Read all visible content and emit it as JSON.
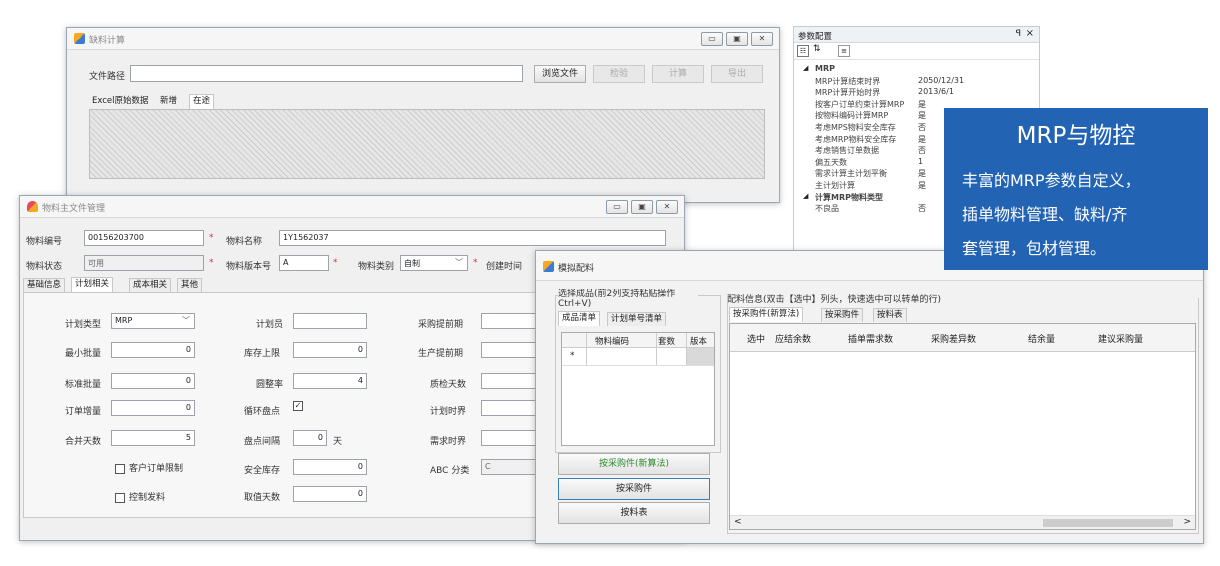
{
  "shortage_window": {
    "title": "缺料计算",
    "file_path_label": "文件路径",
    "file_path_value": "",
    "buttons": [
      "浏览文件",
      "检验",
      "计算",
      "导出"
    ],
    "tabs": [
      "Excel原始数据",
      "新增",
      "在途"
    ]
  },
  "material_window": {
    "title": "物料主文件管理",
    "code_label": "物料编号",
    "code_value": "00156203700",
    "name_label": "物料名称",
    "name_value": "1Y1562037",
    "status_label": "物料状态",
    "status_value": "可用",
    "version_label": "物料版本号",
    "version_value": "A",
    "category_label": "物料类别",
    "category_value": "自制",
    "created_label": "创建时间",
    "required_mark": "*",
    "tabs": [
      "基础信息",
      "计划相关",
      "成本相关",
      "其他"
    ],
    "active_tab_index": 1,
    "fields": {
      "plan_type": {
        "label": "计划类型",
        "value": "MRP"
      },
      "min_batch": {
        "label": "最小批量",
        "value": "0"
      },
      "std_batch": {
        "label": "标准批量",
        "value": "0"
      },
      "order_increment": {
        "label": "订单增量",
        "value": "0"
      },
      "merge_days": {
        "label": "合并天数",
        "value": "5"
      },
      "customer_limit": {
        "label": "客户订单限制",
        "checked": false
      },
      "control_issue": {
        "label": "控制发料",
        "checked": false
      },
      "planner": {
        "label": "计划员",
        "value": ""
      },
      "stock_upper": {
        "label": "库存上限",
        "value": "0"
      },
      "rounding_rate": {
        "label": "圆整率",
        "value": "4"
      },
      "cycle_count": {
        "label": "循环盘点",
        "checked": true
      },
      "count_interval": {
        "label": "盘点间隔",
        "value": "0",
        "unit": "天"
      },
      "safety_stock": {
        "label": "安全库存",
        "value": "0"
      },
      "round_days": {
        "label": "取值天数",
        "value": "0"
      },
      "purchase_lead": {
        "label": "采购提前期"
      },
      "production_lead": {
        "label": "生产提前期"
      },
      "inspect_days": {
        "label": "质检天数"
      },
      "plan_fence": {
        "label": "计划时界"
      },
      "demand_fence": {
        "label": "需求时界"
      },
      "abc_class": {
        "label": "ABC 分类",
        "value": "C"
      }
    }
  },
  "props_panel": {
    "title": "参数配置",
    "pin": "ꟼ",
    "close": "×",
    "groups": [
      {
        "name": "MRP",
        "items": [
          {
            "k": "MRP计算结束时界",
            "v": "2050/12/31"
          },
          {
            "k": "MRP计算开始时界",
            "v": "2013/6/1"
          },
          {
            "k": "按客户订单约束计算MRP",
            "v": "是"
          },
          {
            "k": "按物料编码计算MRP",
            "v": "是"
          },
          {
            "k": "考虑MPS物料安全库存",
            "v": "否"
          },
          {
            "k": "考虑MRP物料安全库存",
            "v": "是"
          },
          {
            "k": "考虑销售订单数据",
            "v": "否"
          },
          {
            "k": "偏五天数",
            "v": "1"
          },
          {
            "k": "需求计算主计划平衡",
            "v": "是"
          },
          {
            "k": "主计划计算",
            "v": "是"
          }
        ]
      },
      {
        "name": "计算MRP物料类型",
        "items": [
          {
            "k": "不良品",
            "v": "否"
          }
        ]
      }
    ]
  },
  "sim_window": {
    "title": "模拟配料",
    "left_group_title": "选择成品(前2列支持粘贴操作 Ctrl+V)",
    "left_tabs": [
      "成品清单",
      "计划单号清单"
    ],
    "left_cols": [
      "物料编码",
      "套数",
      "版本"
    ],
    "new_row_marker": "*",
    "left_buttons": [
      "按采购件(新算法)",
      "按采购件",
      "按料表"
    ],
    "right_group_title": "配料信息(双击【选中】列头，快速选中可以转单的行)",
    "right_tabs": [
      "按采购件(新算法)",
      "按采购件",
      "按料表"
    ],
    "right_cols": [
      "选中",
      "应结余数",
      "插单需求数",
      "采购差异数",
      "结余量",
      "建议采购量"
    ],
    "scroll_left": "<",
    "scroll_right": ">"
  },
  "banner": {
    "title": "MRP与物控",
    "lines": [
      "丰富的MRP参数自定义，",
      "插单物料管理、缺料/齐",
      "套管理，包材管理。"
    ]
  },
  "colors": {
    "banner_bg": "#2263b3",
    "required": "#e23030",
    "green_text": "#2e8b2e"
  }
}
